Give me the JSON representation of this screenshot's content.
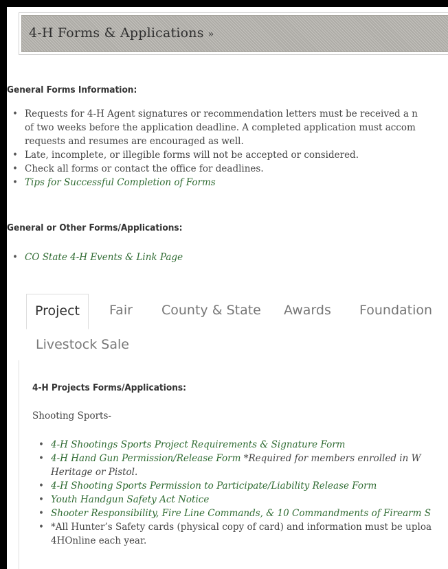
{
  "title": {
    "text": "4-H Forms & Applications",
    "chevron": "»"
  },
  "general_heading": "General Forms Information:",
  "general_items": [
    {
      "lines": [
        "Requests for 4-H Agent signatures or recommendation letters must be received a n",
        "of two weeks before the application deadline. A completed application must accom",
        "requests and resumes are encouraged as well."
      ],
      "link": false
    },
    {
      "lines": [
        "Late, incomplete, or illegible forms will not be accepted or considered."
      ],
      "link": false
    },
    {
      "lines": [
        "Check all forms or contact the office for deadlines."
      ],
      "link": false
    },
    {
      "lines": [
        "Tips for Successful Completion of Forms"
      ],
      "link": true
    }
  ],
  "other_heading": "General or Other Forms/Applications:",
  "other_items": [
    {
      "lines": [
        "CO State 4-H Events & Link Page"
      ],
      "link": true
    }
  ],
  "tabs": [
    "Project",
    "Fair",
    "County & State",
    "Awards",
    "Foundation",
    "Livestock Sale"
  ],
  "active_tab": "Project",
  "project_heading": "4-H Projects Forms/Applications:",
  "shooting_label": "Shooting Sports-",
  "project_items": [
    {
      "parts": [
        {
          "t": "4-H Shootings Sports Project Requirements & Signature Form",
          "link": true
        }
      ]
    },
    {
      "parts": [
        {
          "t": "4-H Hand Gun Permission/Release Form",
          "link": true
        },
        {
          "t": " *Required for members enrolled in W",
          "link": false,
          "italic": true
        }
      ],
      "line2": {
        "t": "Heritage or Pistol.",
        "italic": true
      }
    },
    {
      "parts": [
        {
          "t": "4-H Shooting Sports Permission to Participate/Liability Release Form",
          "link": true
        }
      ]
    },
    {
      "parts": [
        {
          "t": "Youth Handgun Safety Act Notice",
          "link": true
        }
      ]
    },
    {
      "parts": [
        {
          "t": "Shooter Responsibility, Fire Line Commands, & 10 Commandments of Firearm S",
          "link": true
        }
      ]
    },
    {
      "parts": [
        {
          "t": "*All Hunter’s Safety cards (physical copy of card) and information must be uploa",
          "link": false
        }
      ],
      "line2": {
        "t": "4HOnline each year.",
        "italic": false
      }
    }
  ],
  "colors": {
    "link": "#2f6b32",
    "text": "#444444",
    "title_bar": "#b8b6b0"
  }
}
